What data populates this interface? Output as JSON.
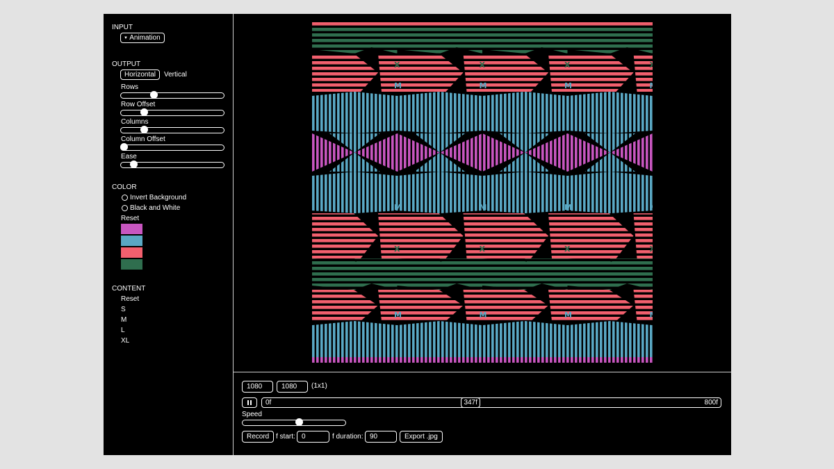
{
  "input": {
    "heading": "INPUT",
    "dropdown_label": "Animation"
  },
  "output": {
    "heading": "OUTPUT",
    "orientation_selected": "Horizontal",
    "orientation_other": "Vertical",
    "sliders": [
      {
        "label": "Rows",
        "value": 0.32
      },
      {
        "label": "Row Offset",
        "value": 0.22
      },
      {
        "label": "Columns",
        "value": 0.22
      },
      {
        "label": "Column Offset",
        "value": 0.03
      },
      {
        "label": "Ease",
        "value": 0.12
      }
    ]
  },
  "color": {
    "heading": "COLOR",
    "invert_label": "Invert Background",
    "bw_label": "Black and White",
    "reset_label": "Reset",
    "swatches": [
      "#c856c0",
      "#5aa8c4",
      "#f2606e",
      "#2f6e4e"
    ]
  },
  "content": {
    "heading": "CONTENT",
    "reset_label": "Reset",
    "sizes": [
      "S",
      "M",
      "L",
      "XL"
    ]
  },
  "pattern": {
    "colors": {
      "pink": "#f2606e",
      "blue": "#5aa8c4",
      "green": "#2f6e4e",
      "magenta": "#c856c0",
      "bg": "#000000"
    },
    "glyphs": [
      "M",
      "X",
      "S",
      "L"
    ]
  },
  "bottom": {
    "width_value": "1080",
    "height_value": "1080",
    "ratio": "(1x1)",
    "pause_icon": "pause-icon",
    "timeline_start": "0f",
    "timeline_current": "347f",
    "timeline_end": "800f",
    "timeline_position": 0.434,
    "speed_label": "Speed",
    "speed_value": 0.55,
    "record_label": "Record",
    "f_start_label": "f start:",
    "f_start_value": "0",
    "f_duration_label": "f duration:",
    "f_duration_value": "90",
    "export_label": "Export .jpg"
  }
}
